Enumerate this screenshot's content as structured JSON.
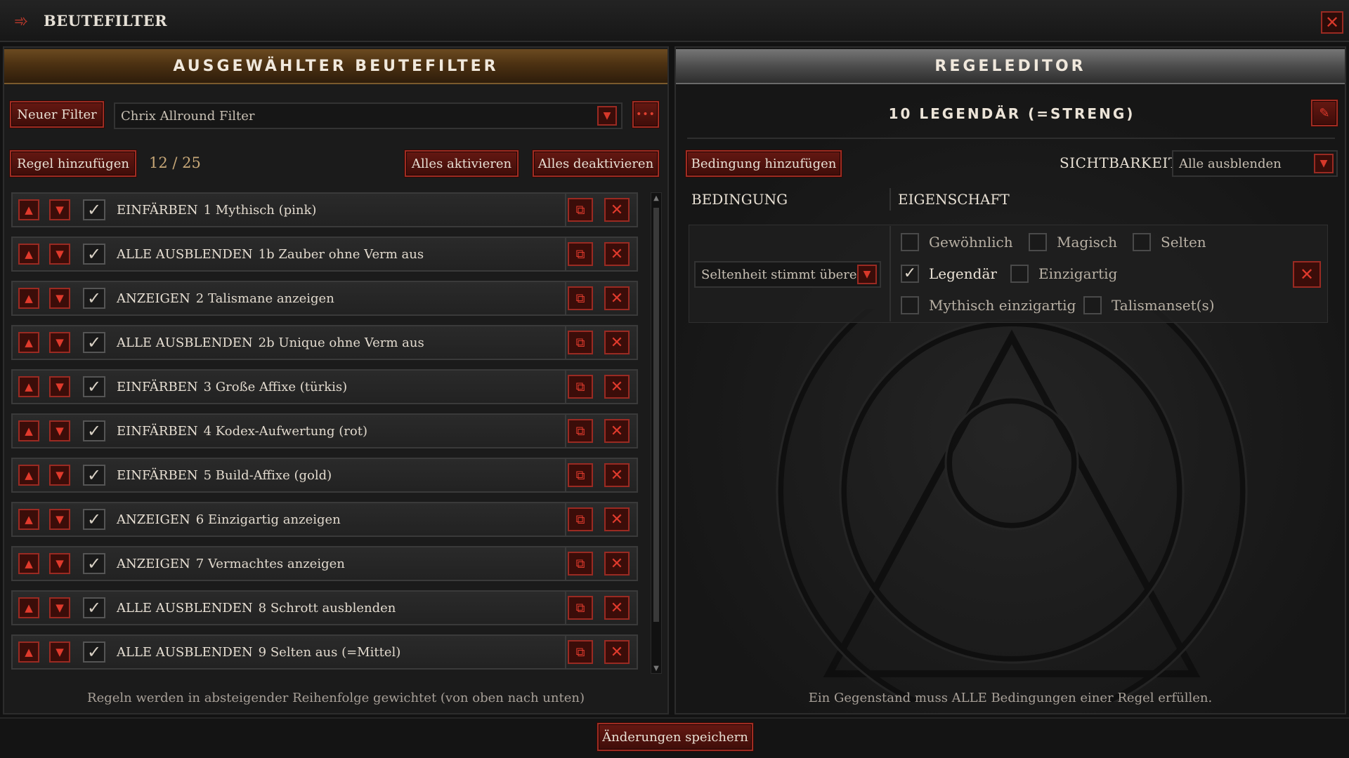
{
  "window": {
    "title": "BEUTEFILTER",
    "close_icon": "close-icon",
    "logo_icon": "arrow-logo-icon"
  },
  "left_panel": {
    "header": "AUSGEWÄHLTER BEUTEFILTER",
    "new_filter_label": "Neuer Filter",
    "filter_name": "Chrix Allround Filter",
    "add_rule_label": "Regel hinzufügen",
    "rule_count": "12 / 25",
    "activate_all_label": "Alles aktivieren",
    "deactivate_all_label": "Alles deaktivieren",
    "rules": [
      {
        "action": "EINFÄRBEN",
        "name": "1 Mythisch (pink)",
        "enabled": true
      },
      {
        "action": "ALLE AUSBLENDEN",
        "name": "1b Zauber ohne Verm aus",
        "enabled": true
      },
      {
        "action": "ANZEIGEN",
        "name": "2 Talismane anzeigen",
        "enabled": true
      },
      {
        "action": "ALLE AUSBLENDEN",
        "name": "2b Unique ohne Verm aus",
        "enabled": true
      },
      {
        "action": "EINFÄRBEN",
        "name": "3 Große Affixe (türkis)",
        "enabled": true
      },
      {
        "action": "EINFÄRBEN",
        "name": "4 Kodex-Aufwertung (rot)",
        "enabled": true
      },
      {
        "action": "EINFÄRBEN",
        "name": "5 Build-Affixe (gold)",
        "enabled": true
      },
      {
        "action": "ANZEIGEN",
        "name": "6 Einzigartig anzeigen",
        "enabled": true
      },
      {
        "action": "ANZEIGEN",
        "name": "7 Vermachtes anzeigen",
        "enabled": true
      },
      {
        "action": "ALLE AUSBLENDEN",
        "name": "8 Schrott ausblenden",
        "enabled": true
      },
      {
        "action": "ALLE AUSBLENDEN",
        "name": "9 Selten aus (=Mittel)",
        "enabled": true
      }
    ],
    "footnote": "Regeln werden in absteigender Reihenfolge gewichtet (von oben nach unten)"
  },
  "right_panel": {
    "header": "REGELEDITOR",
    "rule_title": "10 LEGENDÄR (=STRENG)",
    "add_condition_label": "Bedingung hinzufügen",
    "visibility_label": "SICHTBARKEIT",
    "visibility_value": "Alle ausblenden",
    "col_condition": "BEDINGUNG",
    "col_property": "EIGENSCHAFT",
    "condition_value": "Seltenheit stimmt überein",
    "rarity_options": [
      {
        "label": "Gewöhnlich",
        "checked": false
      },
      {
        "label": "Magisch",
        "checked": false
      },
      {
        "label": "Selten",
        "checked": false
      },
      {
        "label": "Legendär",
        "checked": true
      },
      {
        "label": "Einzigartig",
        "checked": false
      },
      {
        "label": "Mythisch einzigartig",
        "checked": false
      },
      {
        "label": "Talismanset(s)",
        "checked": false
      }
    ],
    "footnote": "Ein Gegenstand muss ALLE Bedingungen einer Regel erfüllen."
  },
  "footer": {
    "save_label": "Änderungen speichern"
  },
  "colors": {
    "accent_red": "#9a2a22",
    "gold_header": "#6b4a20"
  }
}
